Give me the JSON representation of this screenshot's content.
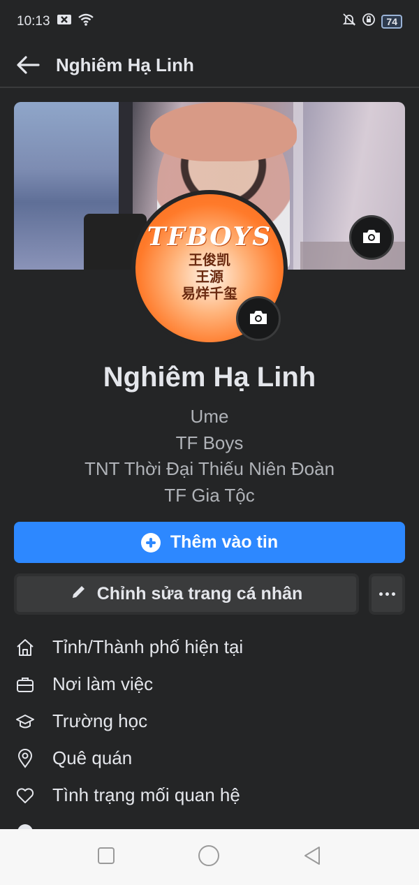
{
  "status_bar": {
    "time": "10:13",
    "battery": "74",
    "icons": [
      "close-notification-icon",
      "wifi-icon",
      "bell-off-icon",
      "rotation-lock-icon",
      "battery-icon"
    ]
  },
  "header": {
    "title": "Nghiêm Hạ Linh",
    "back_icon": "arrow-left-icon"
  },
  "profile": {
    "name": "Nghiêm Hạ Linh",
    "bio": [
      "Ume",
      "TF Boys",
      "TNT Thời Đại Thiếu Niên Đoàn",
      "TF Gia Tộc"
    ],
    "avatar_text": "TFBOYS",
    "avatar_cjk": [
      "王俊凯",
      "王源",
      "易烊千玺"
    ]
  },
  "actions": {
    "add_story": "Thêm vào tin",
    "edit_profile": "Chỉnh sửa trang cá nhân",
    "more_icon": "more-horizontal-icon"
  },
  "details": [
    {
      "icon": "home-icon",
      "label": "Tỉnh/Thành phố hiện tại"
    },
    {
      "icon": "briefcase-icon",
      "label": "Nơi làm việc"
    },
    {
      "icon": "graduation-cap-icon",
      "label": "Trường học"
    },
    {
      "icon": "location-pin-icon",
      "label": "Quê quán"
    },
    {
      "icon": "heart-icon",
      "label": "Tình trạng mối quan hệ"
    }
  ],
  "colors": {
    "background": "#242526",
    "primary": "#2d88ff",
    "secondary_button": "#3a3b3c",
    "text": "#e4e6eb",
    "muted_text": "#b0b3b8"
  }
}
